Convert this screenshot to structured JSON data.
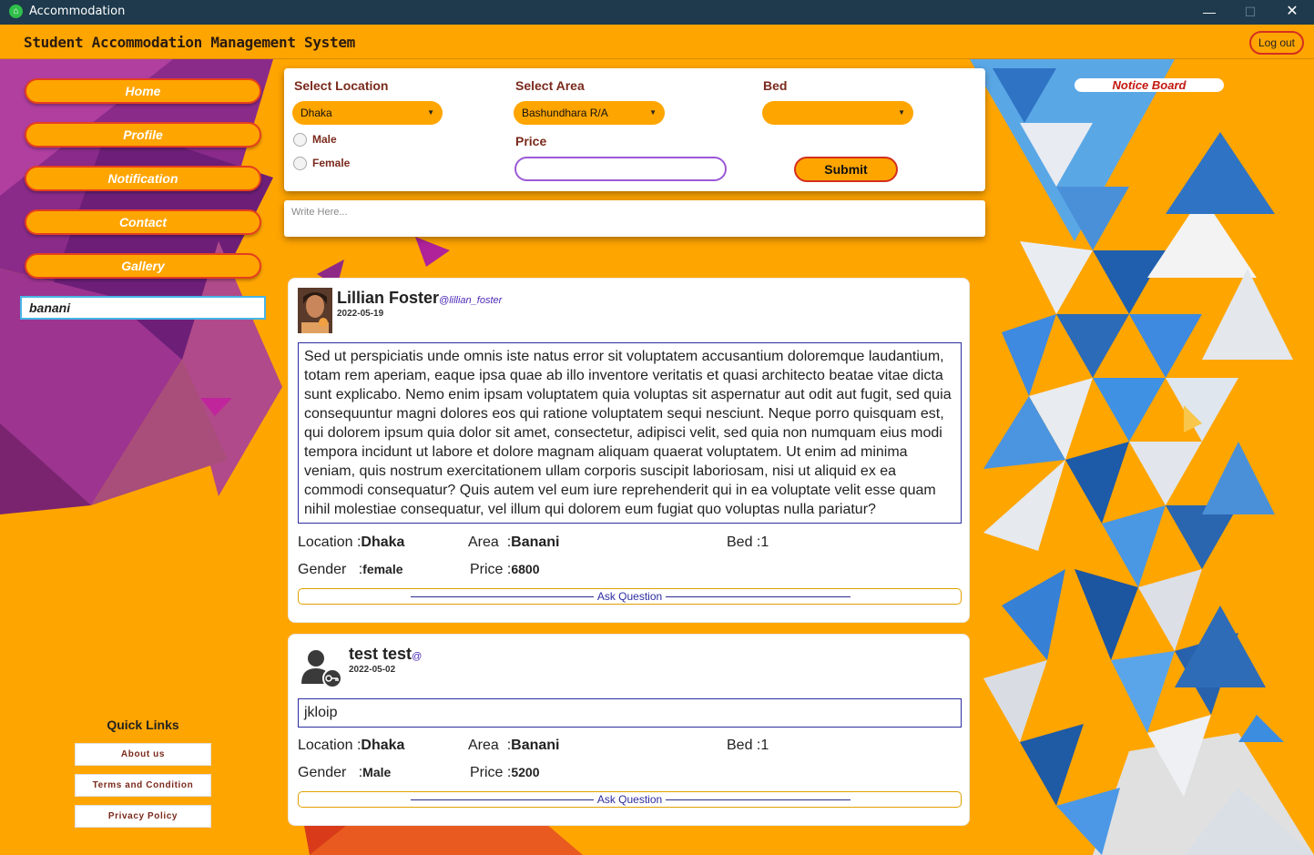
{
  "window": {
    "title": "Accommodation"
  },
  "header": {
    "app_title": "Student Accommodation Management System",
    "logout_label": "Log out"
  },
  "sidebar": {
    "items": [
      {
        "label": "Home"
      },
      {
        "label": "Profile"
      },
      {
        "label": "Notification"
      },
      {
        "label": "Contact"
      },
      {
        "label": "Gallery"
      }
    ],
    "search_value": "banani",
    "quick_links_title": "Quick Links",
    "quick_links": [
      {
        "label": "About us"
      },
      {
        "label": "Terms and Condition"
      },
      {
        "label": "Privacy Policy"
      }
    ]
  },
  "filter": {
    "location_label": "Select Location",
    "location_value": "Dhaka",
    "area_label": "Select Area",
    "area_value": "Bashundhara R/A",
    "bed_label": "Bed",
    "bed_value": "",
    "gender_options": [
      "Male",
      "Female"
    ],
    "price_label": "Price",
    "price_value": "",
    "submit_label": "Submit"
  },
  "compose": {
    "placeholder": "Write Here..."
  },
  "notice_board": {
    "label": "Notice Board"
  },
  "posts": [
    {
      "name": "Lillian Foster",
      "handle": "@lillian_foster",
      "date": "2022-05-19",
      "body": "Sed ut perspiciatis unde omnis iste natus error sit voluptatem accusantium doloremque laudantium, totam rem aperiam, eaque ipsa quae ab illo inventore veritatis et quasi architecto beatae vitae dicta sunt explicabo. Nemo enim ipsam voluptatem quia voluptas sit aspernatur aut odit aut fugit, sed quia consequuntur magni dolores eos qui ratione voluptatem sequi nesciunt. Neque porro quisquam est, qui dolorem ipsum quia dolor sit amet, consectetur, adipisci velit, sed quia non numquam eius modi tempora incidunt ut labore et dolore magnam aliquam quaerat voluptatem. Ut enim ad minima veniam, quis nostrum exercitationem ullam corporis suscipit laboriosam, nisi ut aliquid ex ea commodi consequatur? Quis autem vel eum iure reprehenderit qui in ea voluptate velit esse quam nihil molestiae consequatur, vel illum qui dolorem eum fugiat quo voluptas nulla pariatur?",
      "location_label": "Location :",
      "location": "Dhaka",
      "area_label": "Area  :",
      "area": "Banani",
      "bed_label": "Bed :",
      "bed": "1",
      "gender_label": "Gender   :",
      "gender": "female",
      "price_label": "Price :",
      "price": "6800",
      "ask_label": "Ask Question"
    },
    {
      "name": "test test",
      "handle": "@",
      "date": "2022-05-02",
      "body": "jkloip",
      "location_label": "Location :",
      "location": "Dhaka",
      "area_label": "Area  :",
      "area": "Banani",
      "bed_label": "Bed :",
      "bed": "1",
      "gender_label": "Gender   :",
      "gender": "Male",
      "price_label": "Price :",
      "price": "5200",
      "ask_label": "Ask Question"
    }
  ],
  "icons": {
    "app": "home-icon",
    "minimize": "minimize-icon",
    "maximize": "maximize-icon",
    "close": "close-icon",
    "dropdown": "chevron-down-icon",
    "avatar_default": "user-key-icon"
  }
}
